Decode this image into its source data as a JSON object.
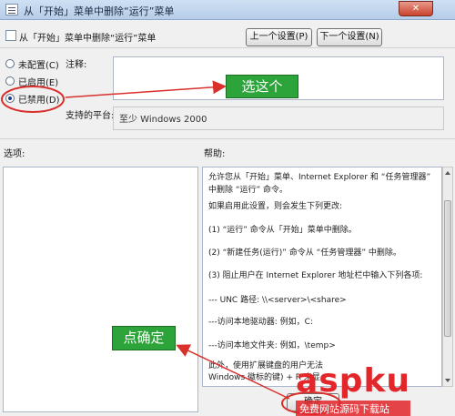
{
  "window": {
    "title": "从「开始」菜单中删除“运行”菜单",
    "close_label": "✕"
  },
  "header": {
    "title": "从「开始」菜单中删除“运行”菜单",
    "prev_button": "上一个设置(P)",
    "next_button": "下一个设置(N)"
  },
  "state": {
    "options": [
      {
        "label": "未配置(C)",
        "checked": false
      },
      {
        "label": "已启用(E)",
        "checked": false
      },
      {
        "label": "已禁用(D)",
        "checked": true
      }
    ]
  },
  "comment": {
    "label": "注释:",
    "value": ""
  },
  "platform": {
    "label": "支持的平台:",
    "value": "至少 Windows 2000"
  },
  "options_pane": {
    "label": "选项:"
  },
  "help_pane": {
    "label": "帮助:",
    "paragraphs": [
      "允许您从「开始」菜单、Internet Explorer 和 “任务管理器” 中删除 “运行” 命令。",
      "如果启用此设置，则会发生下列更改:",
      "(1) “运行” 命令从「开始」菜单中删除。",
      "(2) “新建任务(运行)” 命令从 “任务管理器” 中删除。",
      "(3) 阻止用户在 Internet Explorer 地址栏中输入下列各项:",
      "--- UNC 路径: \\\\<server>\\<share>",
      "---访问本地驱动器: 例如，C:",
      "---访问本地文件夹: 例如，\\temp>",
      "此外，使用扩展键盘的用户无法",
      "Windows 徽标的键) + R 来显"
    ]
  },
  "footer": {
    "ok_button": "确定"
  },
  "annotations": {
    "select_this": "选这个",
    "click_ok": "点确定"
  },
  "watermark": {
    "logo": "aspku",
    "subtitle": "免费网站源码下载站"
  },
  "colors": {
    "annotation_green": "#2da43a",
    "highlight_red": "#d9302c",
    "watermark_red": "#e2262a"
  }
}
